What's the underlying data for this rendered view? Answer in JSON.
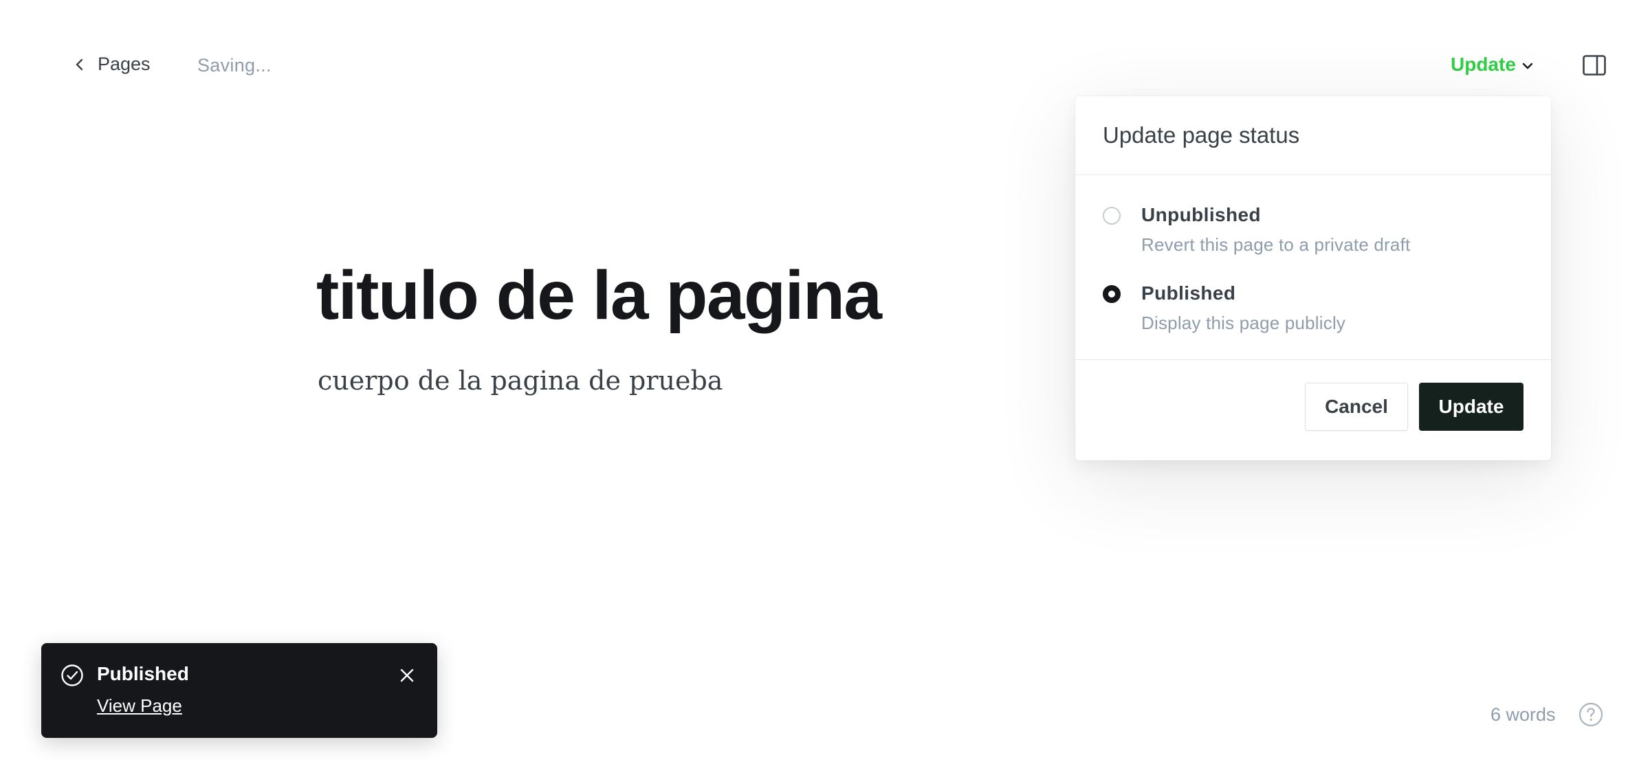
{
  "header": {
    "back_label": "Pages",
    "saving_status": "Saving...",
    "update_trigger_label": "Update",
    "icons": {
      "back": "chevron-left-icon",
      "update_dropdown": "chevron-down-icon",
      "sidebar": "sidebar-toggle-icon"
    }
  },
  "editor": {
    "title": "titulo de la pagina",
    "body": "cuerpo de la pagina de prueba"
  },
  "status_popover": {
    "heading": "Update page status",
    "options": [
      {
        "label": "Unpublished",
        "description": "Revert this page to a private draft",
        "selected": false
      },
      {
        "label": "Published",
        "description": "Display this page publicly",
        "selected": true
      }
    ],
    "cancel_label": "Cancel",
    "update_label": "Update"
  },
  "toast": {
    "title": "Published",
    "link_label": "View Page",
    "icons": {
      "status": "check-circle-icon",
      "close": "close-icon"
    }
  },
  "footer": {
    "word_count": "6 words",
    "help_icon": "help-icon"
  },
  "colors": {
    "accent_green": "#30cf43",
    "primary_dark": "#15211d",
    "muted_text": "#8e9cac",
    "toast_bg": "#15171a"
  }
}
